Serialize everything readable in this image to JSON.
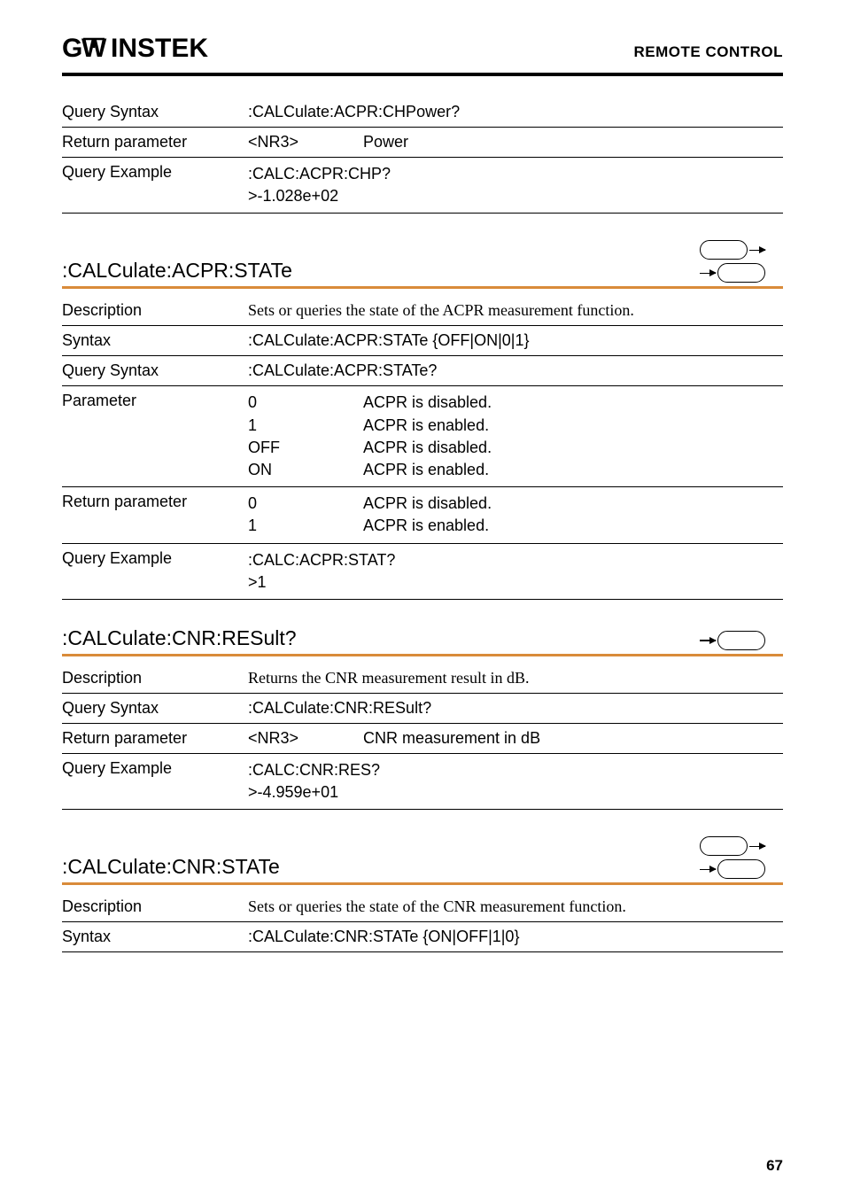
{
  "header": {
    "logo": "GWINSTEK",
    "right": "REMOTE CONTROL"
  },
  "block1": {
    "querySyntax": {
      "label": "Query Syntax",
      "value": ":CALCulate:ACPR:CHPower?"
    },
    "returnParam": {
      "label": "Return parameter",
      "col1": "<NR3>",
      "col2": "Power"
    },
    "queryExample": {
      "label": "Query Example",
      "line1": ":CALC:ACPR:CHP?",
      "line2": ">-1.028e+02"
    }
  },
  "section1": {
    "title": ":CALCulate:ACPR:STATe",
    "description": {
      "label": "Description",
      "value": "Sets or queries the state of the ACPR measurement function."
    },
    "syntax": {
      "label": "Syntax",
      "value": ":CALCulate:ACPR:STATe {OFF|ON|0|1}"
    },
    "querySyntax": {
      "label": "Query Syntax",
      "value": ":CALCulate:ACPR:STATe?"
    },
    "parameter": {
      "label": "Parameter",
      "rows": [
        {
          "c1": "0",
          "c2": "ACPR is disabled."
        },
        {
          "c1": "1",
          "c2": "ACPR is enabled."
        },
        {
          "c1": "OFF",
          "c2": "ACPR is disabled."
        },
        {
          "c1": "ON",
          "c2": "ACPR is enabled."
        }
      ]
    },
    "returnParam": {
      "label": "Return parameter",
      "rows": [
        {
          "c1": "0",
          "c2": "ACPR is disabled."
        },
        {
          "c1": "1",
          "c2": "ACPR is enabled."
        }
      ]
    },
    "queryExample": {
      "label": "Query Example",
      "line1": ":CALC:ACPR:STAT?",
      "line2": ">1"
    }
  },
  "section2": {
    "title": ":CALCulate:CNR:RESult?",
    "description": {
      "label": "Description",
      "value": "Returns the CNR measurement result in dB."
    },
    "querySyntax": {
      "label": "Query Syntax",
      "value": ":CALCulate:CNR:RESult?"
    },
    "returnParam": {
      "label": "Return parameter",
      "col1": "<NR3>",
      "col2": "CNR measurement in dB"
    },
    "queryExample": {
      "label": "Query Example",
      "line1": ":CALC:CNR:RES?",
      "line2": ">-4.959e+01"
    }
  },
  "section3": {
    "title": ":CALCulate:CNR:STATe",
    "description": {
      "label": "Description",
      "value": "Sets or queries the state of the CNR measurement function."
    },
    "syntax": {
      "label": "Syntax",
      "value": ":CALCulate:CNR:STATe {ON|OFF|1|0}"
    }
  },
  "pageNum": "67"
}
